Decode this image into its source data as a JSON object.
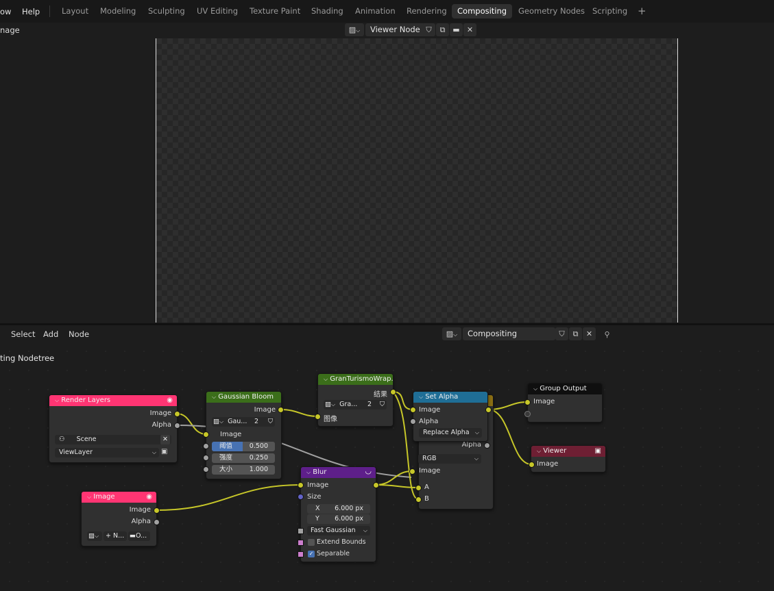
{
  "topbar": {
    "menus": [
      "ow",
      "Help"
    ],
    "workspaces": [
      "Layout",
      "Modeling",
      "Sculpting",
      "UV Editing",
      "Texture Paint",
      "Shading",
      "Animation",
      "Rendering",
      "Compositing",
      "Geometry Nodes",
      "Scripting"
    ],
    "active_workspace": "Compositing",
    "add_tab": "+"
  },
  "image_editor": {
    "header_left": "nage",
    "image_name": "Viewer Node"
  },
  "node_editor": {
    "menus": [
      "Select",
      "Add",
      "Node"
    ],
    "tree_name": "Compositing Nodetree",
    "breadcrumb": "ting Nodetree"
  },
  "nodes": {
    "render_layers": {
      "title": "Render Layers",
      "out_image": "Image",
      "out_alpha": "Alpha",
      "scene": "Scene",
      "view_layer": "ViewLayer"
    },
    "image": {
      "title": "Image",
      "out_image": "Image",
      "out_alpha": "Alpha",
      "new_label": "N...",
      "open_label": "O..."
    },
    "gaussian_bloom": {
      "title": "Gaussian Bloom",
      "out_image": "Image",
      "group_name": "Gau...",
      "users": "2",
      "in_image": "Image",
      "threshold_label": "阈值",
      "threshold_value": "0.500",
      "intensity_label": "强度",
      "intensity_value": "0.250",
      "size_label": "大小",
      "size_value": "1.000"
    },
    "gran_turismo": {
      "title": "GranTurismoWrap...",
      "out_result": "结果",
      "group_name": "Gra...",
      "users": "2",
      "in_image": "图像"
    },
    "blur": {
      "title": "Blur",
      "out_image": "Image",
      "in_image": "Image",
      "in_size": "Size",
      "x_label": "X",
      "x_value": "6.000 px",
      "y_label": "Y",
      "y_value": "6.000 px",
      "filter": "Fast Gaussian",
      "extend_bounds": "Extend Bounds",
      "separable": "Separable",
      "extend_bounds_checked": false,
      "separable_checked": true
    },
    "set_alpha": {
      "title": "Set Alpha",
      "out_image": "Image",
      "in_image": "Image",
      "in_alpha": "Alpha",
      "mode": "Replace Alpha"
    },
    "mix": {
      "out_alpha": "Alpha",
      "blend": "RGB",
      "in_image": "Image",
      "in_a": "A",
      "in_b": "B"
    },
    "group_output": {
      "title": "Group Output",
      "in_image": "Image"
    },
    "viewer": {
      "title": "Viewer",
      "in_image": "Image"
    }
  },
  "colors": {
    "input_header": "#ff3573",
    "group_header": "#3b6e1a",
    "filter_header": "#5e1f8a",
    "converter_header": "#1f6e96",
    "output_header": "#6e1f33",
    "socket_color": "#c7c729",
    "link_color": "#c7c729"
  }
}
